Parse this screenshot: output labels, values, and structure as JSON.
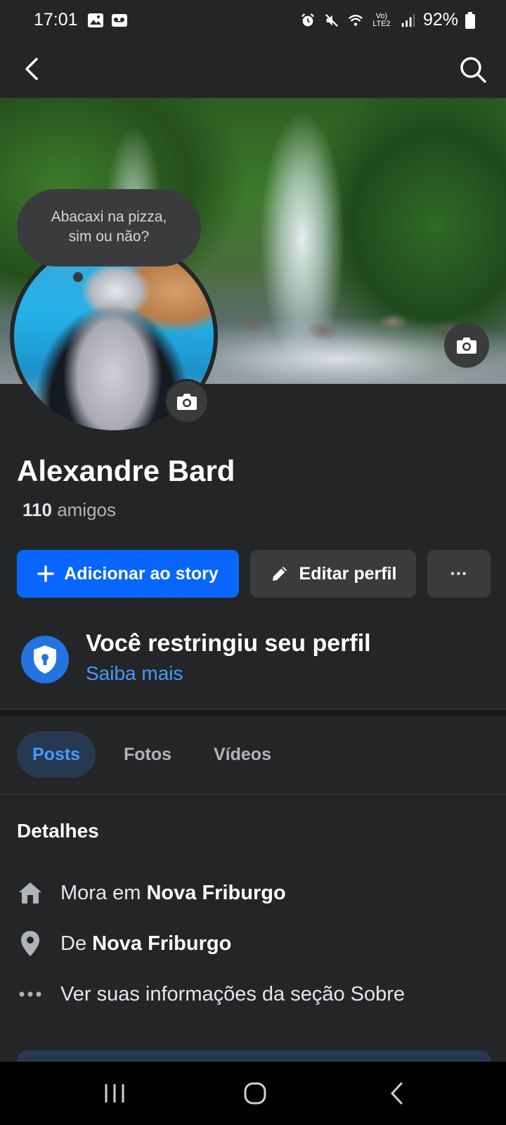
{
  "status_bar": {
    "time": "17:01",
    "battery": "92%",
    "network": "Vo) LTE2",
    "left_icons": [
      "gallery-icon",
      "voicemail-icon"
    ],
    "right_icons": [
      "alarm-icon",
      "mute-icon",
      "wifi-icon",
      "signal-icon",
      "battery-icon"
    ]
  },
  "nav": {
    "back_icon": "back-arrow-icon",
    "search_icon": "search-icon"
  },
  "note": {
    "text_line1": "Abacaxi na pizza,",
    "text_line2": "sim ou não?"
  },
  "profile": {
    "name": "Alexandre Bard",
    "friends_count": "110",
    "friends_label": "amigos"
  },
  "actions": {
    "add_story": "Adicionar ao story",
    "edit_profile": "Editar perfil",
    "more": "···"
  },
  "restriction": {
    "title": "Você restringiu seu perfil",
    "link": "Saiba mais"
  },
  "tabs": [
    {
      "label": "Posts",
      "active": true
    },
    {
      "label": "Fotos",
      "active": false
    },
    {
      "label": "Vídeos",
      "active": false
    }
  ],
  "details": {
    "title": "Detalhes",
    "lives_prefix": "Mora em",
    "lives_city": "Nova Friburgo",
    "from_prefix": "De",
    "from_city": "Nova Friburgo",
    "about_link": "Ver suas informações da seção Sobre"
  },
  "colors": {
    "background": "#242526",
    "accent_blue": "#0866ff",
    "link_blue": "#4599ff",
    "button_gray": "#3a3b3c"
  }
}
